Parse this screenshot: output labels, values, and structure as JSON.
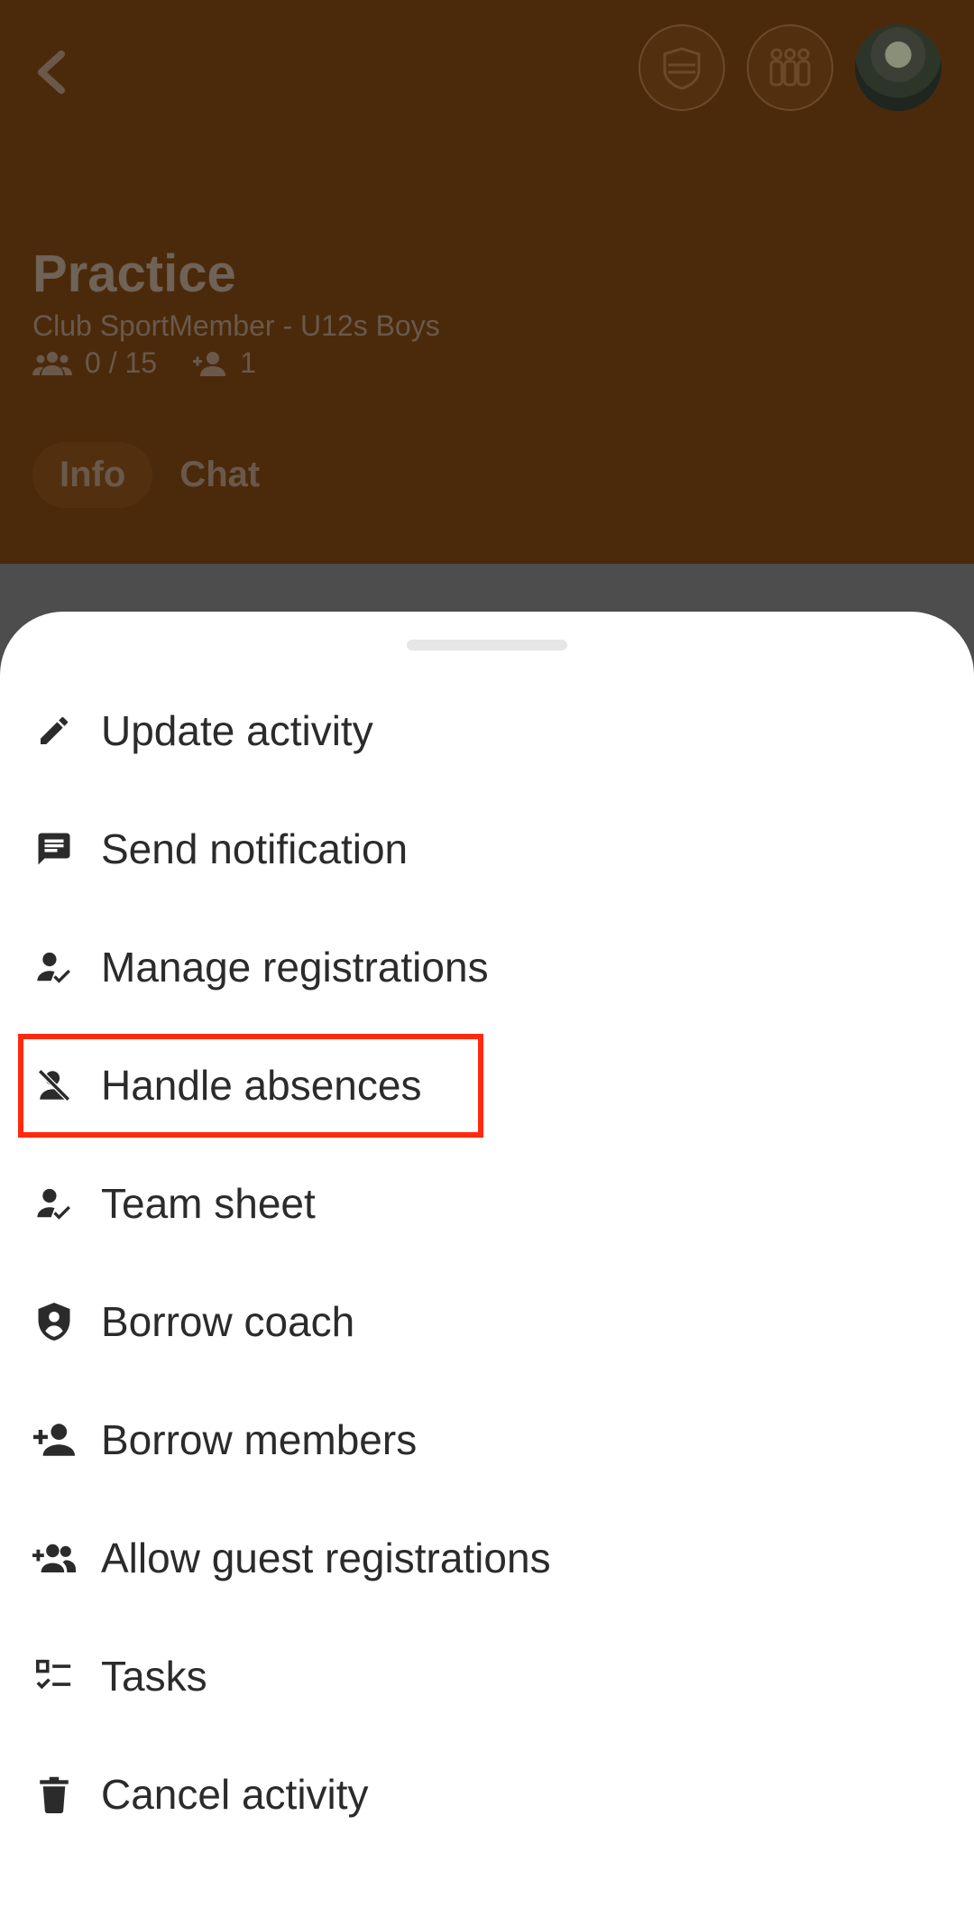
{
  "header": {
    "title": "Practice",
    "subtitle": "Club SportMember - U12s Boys",
    "participants": "0 / 15",
    "guests": "1",
    "tabs": [
      {
        "label": "Info",
        "active": true
      },
      {
        "label": "Chat",
        "active": false
      }
    ],
    "icons": [
      "back-arrow-icon",
      "club-badge-icon",
      "team-members-icon",
      "profile-avatar"
    ]
  },
  "sheet": {
    "items": [
      {
        "label": "Update activity",
        "icon": "pencil-icon"
      },
      {
        "label": "Send notification",
        "icon": "message-icon"
      },
      {
        "label": "Manage registrations",
        "icon": "person-check-icon"
      },
      {
        "label": "Handle absences",
        "icon": "person-off-icon",
        "highlighted": true
      },
      {
        "label": "Team sheet",
        "icon": "person-check-icon"
      },
      {
        "label": "Borrow coach",
        "icon": "shield-person-icon"
      },
      {
        "label": "Borrow members",
        "icon": "person-add-icon"
      },
      {
        "label": "Allow guest registrations",
        "icon": "group-add-icon"
      },
      {
        "label": "Tasks",
        "icon": "checklist-icon"
      },
      {
        "label": "Cancel activity",
        "icon": "trash-icon"
      }
    ]
  },
  "colors": {
    "header_bg": "#4b2a0c",
    "scrim": "#4d4d4d",
    "highlight": "#ff2a0e",
    "text": "#2b2b2b"
  }
}
